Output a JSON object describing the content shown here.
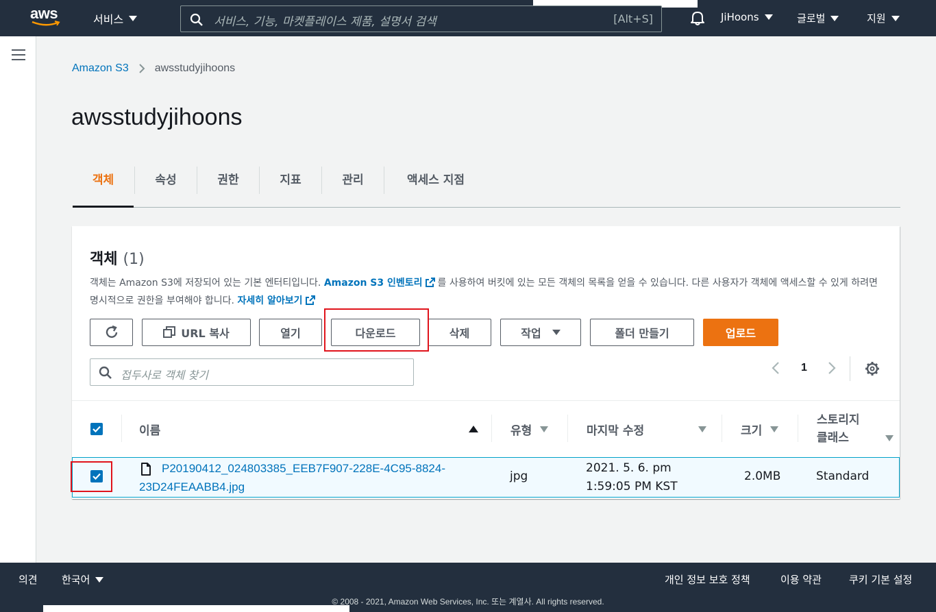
{
  "topnav": {
    "logo_text": "aws",
    "services_label": "서비스",
    "search_placeholder": "서비스, 기능, 마켓플레이스 제품, 설명서 검색",
    "search_shortcut": "[Alt+S]",
    "user_label": "JiHoons",
    "region_label": "글로벌",
    "support_label": "지원"
  },
  "breadcrumb": {
    "root": "Amazon S3",
    "current": "awsstudyjihoons"
  },
  "page_title": "awsstudyjihoons",
  "tabs": [
    {
      "label": "객체",
      "active": true
    },
    {
      "label": "속성",
      "active": false
    },
    {
      "label": "권한",
      "active": false
    },
    {
      "label": "지표",
      "active": false
    },
    {
      "label": "관리",
      "active": false
    },
    {
      "label": "액세스 지점",
      "active": false
    }
  ],
  "objects_panel": {
    "title": "객체",
    "count": "(1)",
    "desc_part1": "객체는 Amazon S3에 저장되어 있는 기본 엔터티입니다. ",
    "desc_link1": "Amazon S3 인벤토리",
    "desc_part2": "를 사용하여 버킷에 있는 모든 객체의 목록을 얻을 수 있습니다. 다른 사용자가 객체에 액세스할 수 있게 하려면 명시적으로 권한을 부여해야 합니다. ",
    "desc_link2": "자세히 알아보기",
    "buttons": {
      "copy_url": "URL 복사",
      "open": "열기",
      "download": "다운로드",
      "delete": "삭제",
      "actions": "작업",
      "create_folder": "폴더 만들기",
      "upload": "업로드"
    },
    "filter_placeholder": "접두사로 객체 찾기",
    "page_number": "1",
    "columns": {
      "name": "이름",
      "type": "유형",
      "last_modified": "마지막 수정",
      "size": "크기",
      "storage_class_line1": "스토리지",
      "storage_class_line2": "클래스"
    },
    "rows": [
      {
        "name_line1": "P20190412_024803385_EEB7F907-228E-4C95-8824-",
        "name_line2": "23D24FEAABB4.jpg",
        "type": "jpg",
        "modified_line1": "2021. 5. 6. pm",
        "modified_line2": "1:59:05 PM KST",
        "size": "2.0MB",
        "storage_class": "Standard",
        "selected": true
      }
    ]
  },
  "footer": {
    "feedback": "의견",
    "language": "한국어",
    "privacy": "개인 정보 보호 정책",
    "terms": "이용 약관",
    "cookies": "쿠키 기본 설정",
    "copyright": "© 2008 - 2021, Amazon Web Services, Inc. 또는 계열사. All rights reserved."
  },
  "colors": {
    "nav_bg": "#232f3e",
    "accent_orange": "#ec7211",
    "link_blue": "#0073bb",
    "highlight_red": "#e0131b"
  }
}
